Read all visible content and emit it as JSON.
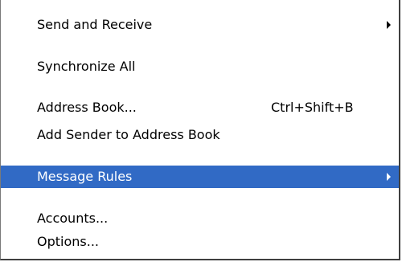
{
  "menu": {
    "items": [
      {
        "label": "Send and Receive",
        "shortcut": "",
        "submenu": true,
        "highlighted": false,
        "icon": "submenu-arrow-icon"
      },
      {
        "label": "Synchronize All",
        "shortcut": "",
        "submenu": false,
        "highlighted": false
      },
      {
        "label": "Address Book...",
        "shortcut": "Ctrl+Shift+B",
        "submenu": false,
        "highlighted": false
      },
      {
        "label": "Add Sender to Address Book",
        "shortcut": "",
        "submenu": false,
        "highlighted": false
      },
      {
        "label": "Message Rules",
        "shortcut": "",
        "submenu": true,
        "highlighted": true,
        "icon": "submenu-arrow-icon"
      },
      {
        "label": "Accounts...",
        "shortcut": "",
        "submenu": false,
        "highlighted": false
      },
      {
        "label": "Options...",
        "shortcut": "",
        "submenu": false,
        "highlighted": false
      }
    ]
  },
  "colors": {
    "highlight_background": "#316ac5",
    "highlight_text": "#ffffff",
    "menu_background": "#ffffff",
    "separator": "#aca899"
  }
}
